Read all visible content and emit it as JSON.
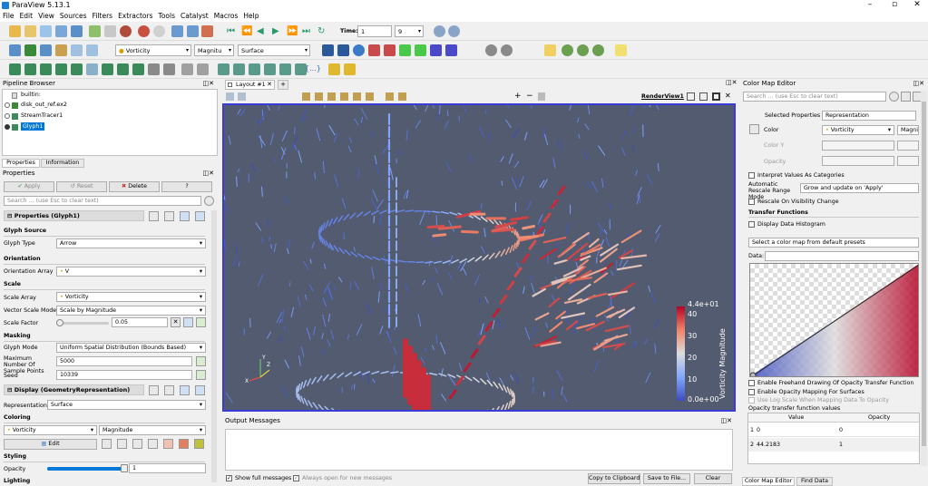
{
  "app": {
    "title": "ParaView 5.13.1"
  },
  "menu": [
    "File",
    "Edit",
    "View",
    "Sources",
    "Filters",
    "Extractors",
    "Tools",
    "Catalyst",
    "Macros",
    "Help"
  ],
  "toolbar": {
    "time_label": "Time:",
    "time_value": "1",
    "time_step": "9",
    "vorticity": "Vorticity",
    "magnitude": "Magnitu",
    "representation": "Surface"
  },
  "pipeline": {
    "title": "Pipeline Browser",
    "items": [
      "builtin:",
      "disk_out_ref.ex2",
      "StreamTracer1",
      "Glyph1"
    ]
  },
  "props_tabs": [
    "Properties",
    "Information"
  ],
  "properties": {
    "title": "Properties",
    "apply": "Apply",
    "reset": "Reset",
    "delete": "Delete",
    "help": "?",
    "search_placeholder": "Search ... (use Esc to clear text)",
    "section_glyph": "Properties (Glyph1)",
    "glyph_source": "Glyph Source",
    "glyph_type_label": "Glyph Type",
    "glyph_type": "Arrow",
    "orientation": "Orientation",
    "orientation_array_label": "Orientation Array",
    "orientation_array": "V",
    "scale": "Scale",
    "scale_array_label": "Scale Array",
    "scale_array": "Vorticity",
    "vector_scale_mode_label": "Vector Scale Mode",
    "vector_scale_mode": "Scale by Magnitude",
    "scale_factor_label": "Scale Factor",
    "scale_factor": "0.05",
    "masking": "Masking",
    "glyph_mode_label": "Glyph Mode",
    "glyph_mode": "Uniform Spatial Distribution (Bounds Based)",
    "max_points_label": "Maximum Number Of Sample Points",
    "max_points": "5000",
    "seed_label": "Seed",
    "seed": "10339",
    "section_display": "Display (GeometryRepresentation)",
    "representation_label": "Representation",
    "representation": "Surface",
    "coloring": "Coloring",
    "color_array": "Vorticity",
    "color_component": "Magnitude",
    "edit": "Edit",
    "styling": "Styling",
    "opacity_label": "Opacity",
    "opacity_value": "1",
    "opacity_level": 1.0,
    "lighting": "Lighting"
  },
  "layout": {
    "tab": "Layout #1",
    "add_tab": "+",
    "view_name": "RenderView1"
  },
  "colorbar": {
    "title": "Vorticity Magnitude",
    "max": "4.4e+01",
    "min": "0.0e+00",
    "ticks": [
      "40",
      "30",
      "20",
      "10"
    ]
  },
  "axes": {
    "x": "X",
    "y": "Y",
    "z": "Z"
  },
  "output": {
    "title": "Output Messages",
    "show_full": "Show full messages",
    "always_open": "Always open for new messages",
    "copy": "Copy to Clipboard",
    "save": "Save to File...",
    "clear": "Clear"
  },
  "cme": {
    "title": "Color Map Editor",
    "search_placeholder": "Search ... (use Esc to clear text)",
    "selected_properties_label": "Selected Properties",
    "selected_properties": "Representation",
    "color_label": "Color",
    "color_array": "Vorticity",
    "color_comp": "Magnitu",
    "color_y_label": "Color Y",
    "opacity_label": "Opacity",
    "interpret_categories": "Interpret Values As Categories",
    "auto_rescale_label": "Automatic Rescale Range Mode",
    "auto_rescale": "Grow and update on 'Apply'",
    "rescale_visibility": "Rescale On Visibility Change",
    "transfer_functions": "Transfer Functions",
    "display_histogram": "Display Data Histogram",
    "preset": "Select a color map from default presets",
    "data_label": "Data:",
    "freehand": "Enable Freehand Drawing Of Opacity Transfer Function",
    "opacity_surfaces": "Enable Opacity Mapping For Surfaces",
    "log_scale": "Use Log Scale When Mapping Data To Opacity",
    "otf_values": "Opacity transfer function values",
    "col_value": "Value",
    "col_opacity": "Opacity",
    "rows": [
      {
        "idx": "1",
        "value": "0",
        "opacity": "0"
      },
      {
        "idx": "2",
        "value": "44.2183",
        "opacity": "1"
      }
    ],
    "tabs": [
      "Color Map Editor",
      "Find Data"
    ]
  },
  "colors": {
    "accent": "#3a3ad8",
    "view_bg": "#525b6f",
    "selection": "#0078d7"
  }
}
